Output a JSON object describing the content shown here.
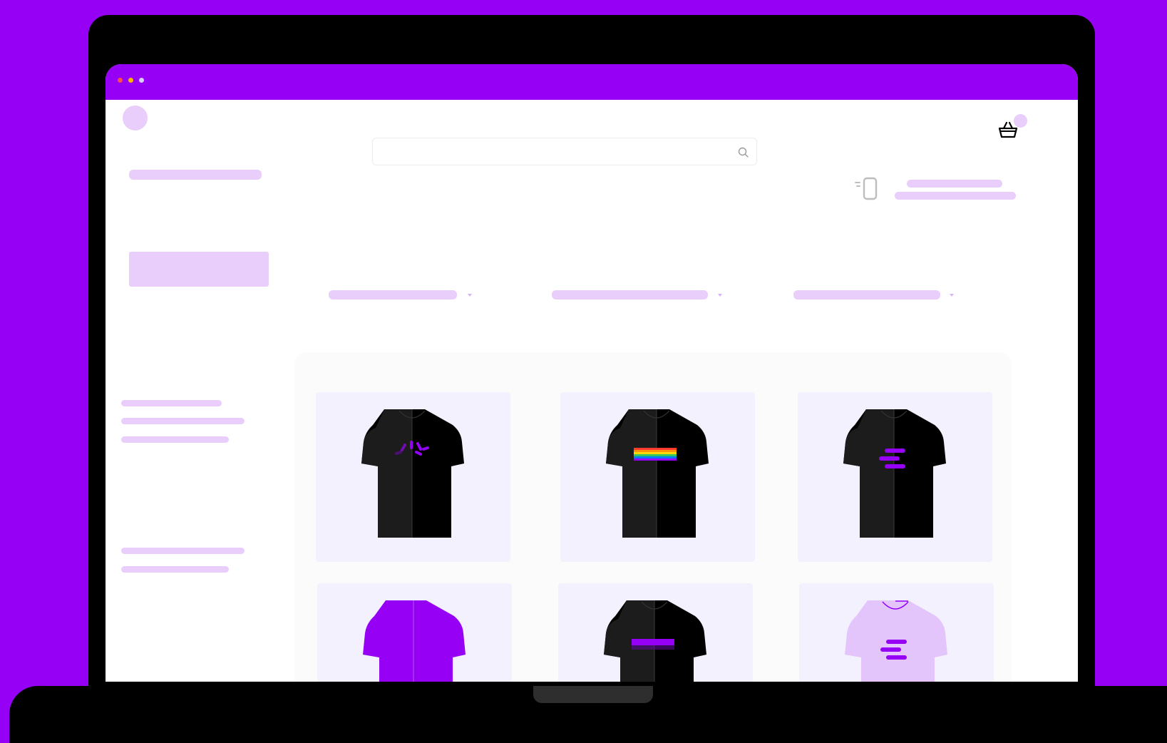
{
  "window": {
    "dots": [
      {
        "name": "close-dot",
        "color": "#ff4b4b"
      },
      {
        "name": "minimize-dot",
        "color": "#ffb800"
      },
      {
        "name": "maximize-dot",
        "color": "#d9cfff"
      }
    ]
  },
  "colors": {
    "brand": "#9601f5",
    "skeleton": "#e9cdfa",
    "card_bg": "#f3f1fe",
    "shirt_black": "#000000",
    "shirt_purple": "#9601f5",
    "shirt_lilac": "#e3c4fb"
  },
  "header": {
    "search": {
      "placeholder": "",
      "icon": "search-icon"
    },
    "cart": {
      "icon": "shopping-basket-icon"
    },
    "device": {
      "icon": "phone-icon"
    }
  },
  "filters": [
    {
      "label": "",
      "icon": "chevron-down-icon"
    },
    {
      "label": "",
      "icon": "chevron-down-icon"
    },
    {
      "label": "",
      "icon": "chevron-down-icon"
    }
  ],
  "products": [
    {
      "shirt": "black",
      "print": "spinner-logo"
    },
    {
      "shirt": "black",
      "print": "rainbow-stripes"
    },
    {
      "shirt": "black",
      "print": "brand-bars-logo"
    },
    {
      "shirt": "purple",
      "print": "none"
    },
    {
      "shirt": "black",
      "print": "purple-bar"
    },
    {
      "shirt": "lilac",
      "print": "brand-bars-logo"
    }
  ]
}
